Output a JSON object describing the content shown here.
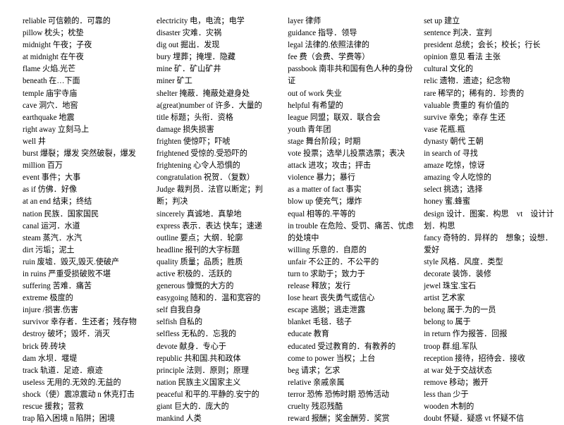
{
  "document": {
    "type": "vocabulary-word-list",
    "language_pair": "English-Chinese",
    "columns": [
      {
        "id": "column-1",
        "entries": [
          "reliable 可信赖的．可靠的",
          "pillow 枕头；枕垫",
          "midnight 午夜；子夜",
          "at midnight 在午夜",
          "flame 火焰.光芒",
          "beneath 在…下面",
          "temple 庙宇寺庙",
          "cave 洞穴．地窖",
          "earthquake 地震",
          "right away 立刻马上",
          "well 井",
          "burst 爆裂；爆发 突然破裂，爆发",
          "million 百万",
          "event 事件；大事",
          "as if 仿佛．好像",
          "at an end 结束；终结",
          "nation 民族．国家国民",
          "canal 运河．水道",
          "steam 蒸汽．水汽",
          "dirt 污垢；泥土",
          "ruin 废墟．毁灭,毁灭.使破产",
          "in ruins 严重受损破败不堪",
          "suffering 苦难．痛苦",
          "extreme 极度的",
          "injure /损害.伤害",
          "survivor 幸存者．生还者；残存物",
          "destroy 破坏；毁坏．消灭",
          "brick 砖.砖块",
          "dam 水坝．堰堤",
          "track 轨道．足迹．痕迹",
          "useless 无用的.无效的.无益的",
          "shock（使）震凉震动 n 休克打击",
          "rescue 援救；营救",
          "trap 陷入困境 n 陷阱；困境"
        ]
      },
      {
        "id": "column-2",
        "entries": [
          "electricity 电，电流；电学",
          "disaster 灾难．灾祸",
          "dig out 掘出．发现",
          "bury 埋葬；掩埋．隐藏",
          "mine 矿．矿山矿井",
          "miner 矿工",
          "shelter 掩蔽．掩蔽处避身处",
          "a(great)number of 许多．大量的",
          "title 标题；头衔．资格",
          "damage 损失损害",
          "frighten 使惊吓；吓唬",
          "frightened 受惊的.受恐吓的",
          "frightening 心令人恐惧的",
          "congratulation 祝贺．（复数）",
          "Judge 裁判员．法官以断定；判断；判决",
          "sincerely 真诚地．真挚地",
          "express 表示．表达 快车；速递",
          "outline 要点；大纲．轮廓",
          "headline 报刊的大字标题",
          "quality 质量；品质；胜质",
          "active 积极的．活跃的",
          "generous 慷慨的大方的",
          "easygoing 随和的．温和宽容的",
          "self 自我自身",
          "selfish 自私的",
          "selfless 无私的．忘我的",
          "devote 献身．专心于",
          "republic 共和国.共和政体",
          "principle 法则．原则；原理",
          "nation 民族主义国家主义",
          "peaceful 和平的.平静的.安宁的",
          "giant 巨大的．庞大的",
          "mankind 人类"
        ]
      },
      {
        "id": "column-3",
        "entries": [
          "layer 律师",
          "guidance 指导．领导",
          "legal 法律的.依照法律的",
          "fee 费（会费、学费等）",
          "passbook 南非共和国有色人种的身份证",
          "out of work 失业",
          "helpful 有希望的",
          "league 同盟；联双．联合会",
          "youth 青年团",
          "stage 舞台阶段；时期",
          "vote 投票；选举儿投票选票；表决",
          "attack 进攻；攻击；抨击",
          "violence 暴力；暴行",
          "as a matter of fact 事实",
          "blow up 使充气；爆炸",
          "equal 相等的.平等的",
          "in trouble 在危险、受罚、痛苦、忧虑的处境中",
          "willing 乐意的．自愿的",
          "unfair 不公正的．不公平的",
          "turn to 求助于；致力于",
          "release 释放；发行",
          "lose heart 丧失勇气或信心",
          "escape 逃脱；逃走泄露",
          "blanket 毛毯．毯子",
          "educate 教育",
          "educated 受过教育的．有教养的",
          "come to power 当权；上台",
          "beg 请求；乞求",
          "relative 亲戚亲属",
          "terror 恐怖 恐怖时期 恐怖活动",
          "cruelty 残忍残酷",
          "reward 报酬；奖金酬劳．奖赏"
        ]
      },
      {
        "id": "column-4",
        "entries": [
          "set up 建立",
          "sentence 判决．宣判",
          "president 总统；会长；校长；行长",
          "opinion 意见 看法 主张",
          "cultural 文化的",
          "relic 遗物．遗迹；纪念物",
          "rare 稀罕的；稀有的．珍贵的",
          "valuable 贵重的 有价值的",
          "survive 幸免；幸存 生还",
          "vase 花瓶.瓶",
          "dynasty 朝代 王朝",
          "in search of 寻找",
          "amaze 吃惊，惊讶",
          "amazing 令人吃惊的",
          "select 挑选；选择",
          "honey 蜜.蜂蜜",
          "design 设计．图案．构思　vt　设计计划．构思",
          "fancy 奇特的．异样的　想象；设想．爱好",
          "style 风格．风度．类型",
          "decorate 装饰．装修",
          "jewel 珠宝.宝石",
          "artist 艺术家",
          "belong 属于.为的一员",
          "belong to 属于",
          "in return 作为报答．回报",
          "troop 群.组.军队",
          "reception 接待，招待会．接收",
          "at war 处于交战状态",
          "remove 移动；搬开",
          "less than 少于",
          "wooden 木制的",
          "doubt 怀疑．疑惑 vt 怀疑不信"
        ]
      }
    ]
  }
}
